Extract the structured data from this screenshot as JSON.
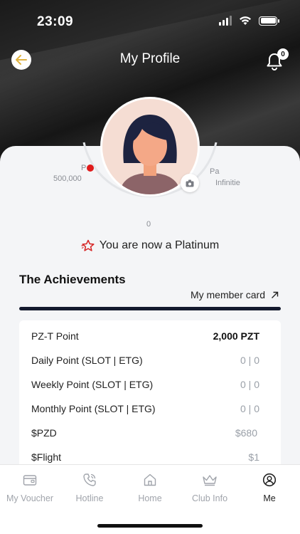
{
  "status": {
    "time": "23:09"
  },
  "header": {
    "title": "My Profile",
    "notification_count": "0"
  },
  "profile": {
    "left_label": "P",
    "left_value": "500,000",
    "right_label": "Pa",
    "right_value": "Infinitie",
    "bottom_value": "0",
    "tier_message": "You are now a Platinum"
  },
  "achievements": {
    "title": "The Achievements",
    "member_card_link": "My member card",
    "progress": 1.0
  },
  "points": [
    {
      "label": "PZ-T Point",
      "value": "2,000 PZT"
    },
    {
      "label": "Daily Point (SLOT | ETG)",
      "value": "0 | 0"
    },
    {
      "label": "Weekly Point (SLOT | ETG)",
      "value": "0 | 0"
    },
    {
      "label": "Monthly Point (SLOT | ETG)",
      "value": "0 | 0"
    },
    {
      "label": "$PZD",
      "value": "$680"
    },
    {
      "label": "$Flight",
      "value": "$1"
    }
  ],
  "tabs": [
    {
      "label": "My Voucher",
      "icon": "voucher-icon"
    },
    {
      "label": "Hotline",
      "icon": "phone-icon"
    },
    {
      "label": "Home",
      "icon": "home-icon"
    },
    {
      "label": "Club Info",
      "icon": "crown-icon"
    },
    {
      "label": "Me",
      "icon": "user-icon",
      "active": true
    }
  ],
  "colors": {
    "accent_red": "#e01b1b",
    "dark": "#141a2e",
    "back_arrow": "#e0b341"
  }
}
